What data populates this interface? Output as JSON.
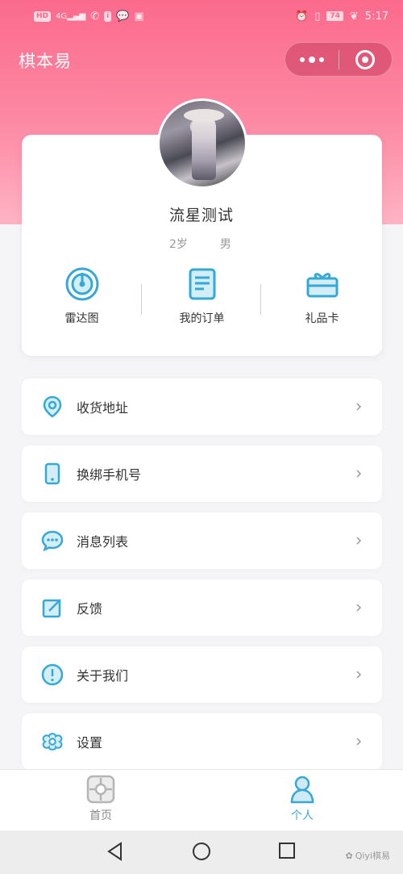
{
  "status_bar": {
    "left_chips": [
      "HD",
      "4G"
    ],
    "time": "5:17",
    "battery": "74"
  },
  "header": {
    "title": "棋本易"
  },
  "profile": {
    "name": "流星测试",
    "age": "2岁",
    "gender": "男"
  },
  "quick_actions": [
    {
      "label": "雷达图",
      "icon": "radar-icon"
    },
    {
      "label": "我的订单",
      "icon": "order-icon"
    },
    {
      "label": "礼品卡",
      "icon": "gift-card-icon"
    }
  ],
  "menu": [
    {
      "label": "收货地址",
      "icon": "location-pin-icon"
    },
    {
      "label": "换绑手机号",
      "icon": "phone-icon"
    },
    {
      "label": "消息列表",
      "icon": "message-icon"
    },
    {
      "label": "反馈",
      "icon": "edit-icon"
    },
    {
      "label": "关于我们",
      "icon": "info-icon"
    },
    {
      "label": "设置",
      "icon": "settings-flower-icon"
    }
  ],
  "tabbar": {
    "tabs": [
      {
        "label": "首页",
        "icon": "home-board-icon",
        "active": false
      },
      {
        "label": "个人",
        "icon": "person-icon",
        "active": true
      }
    ]
  },
  "watermark": "Qiyi棋易",
  "colors": {
    "accent": "#36a8d6",
    "header_gradient_top": "#fb6a8c",
    "header_gradient_bottom": "#feb3c4"
  }
}
